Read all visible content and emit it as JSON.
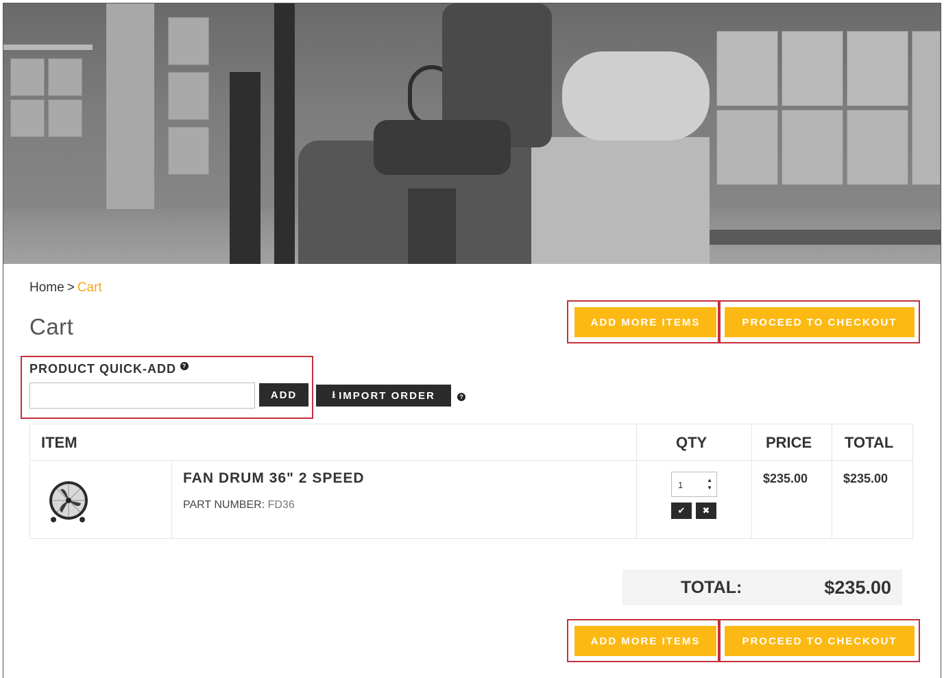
{
  "breadcrumb": {
    "home": "Home",
    "separator": ">",
    "current": "Cart"
  },
  "page_title": "Cart",
  "actions": {
    "add_more": "ADD MORE ITEMS",
    "checkout": "PROCEED TO CHECKOUT"
  },
  "quick_add": {
    "label": "PRODUCT QUICK-ADD",
    "help": "?",
    "input_value": "",
    "add_button": "ADD"
  },
  "import": {
    "label": "IMPORT ORDER",
    "icon": "upload-icon",
    "help": "?"
  },
  "table": {
    "headers": {
      "item": "ITEM",
      "qty": "QTY",
      "price": "PRICE",
      "total": "TOTAL"
    },
    "rows": [
      {
        "name": "FAN DRUM 36\" 2 SPEED",
        "part_label": "PART NUMBER:",
        "part_number": "FD36",
        "qty": "1",
        "price": "$235.00",
        "total": "$235.00",
        "image": "drum-fan-icon"
      }
    ],
    "confirm_icon": "✔",
    "remove_icon": "✖"
  },
  "summary": {
    "label": "TOTAL:",
    "value": "$235.00"
  },
  "colors": {
    "accent": "#fdb913",
    "highlight": "#c62f3a",
    "dark_button": "#2b2b2b",
    "link": "#f4a81d"
  }
}
